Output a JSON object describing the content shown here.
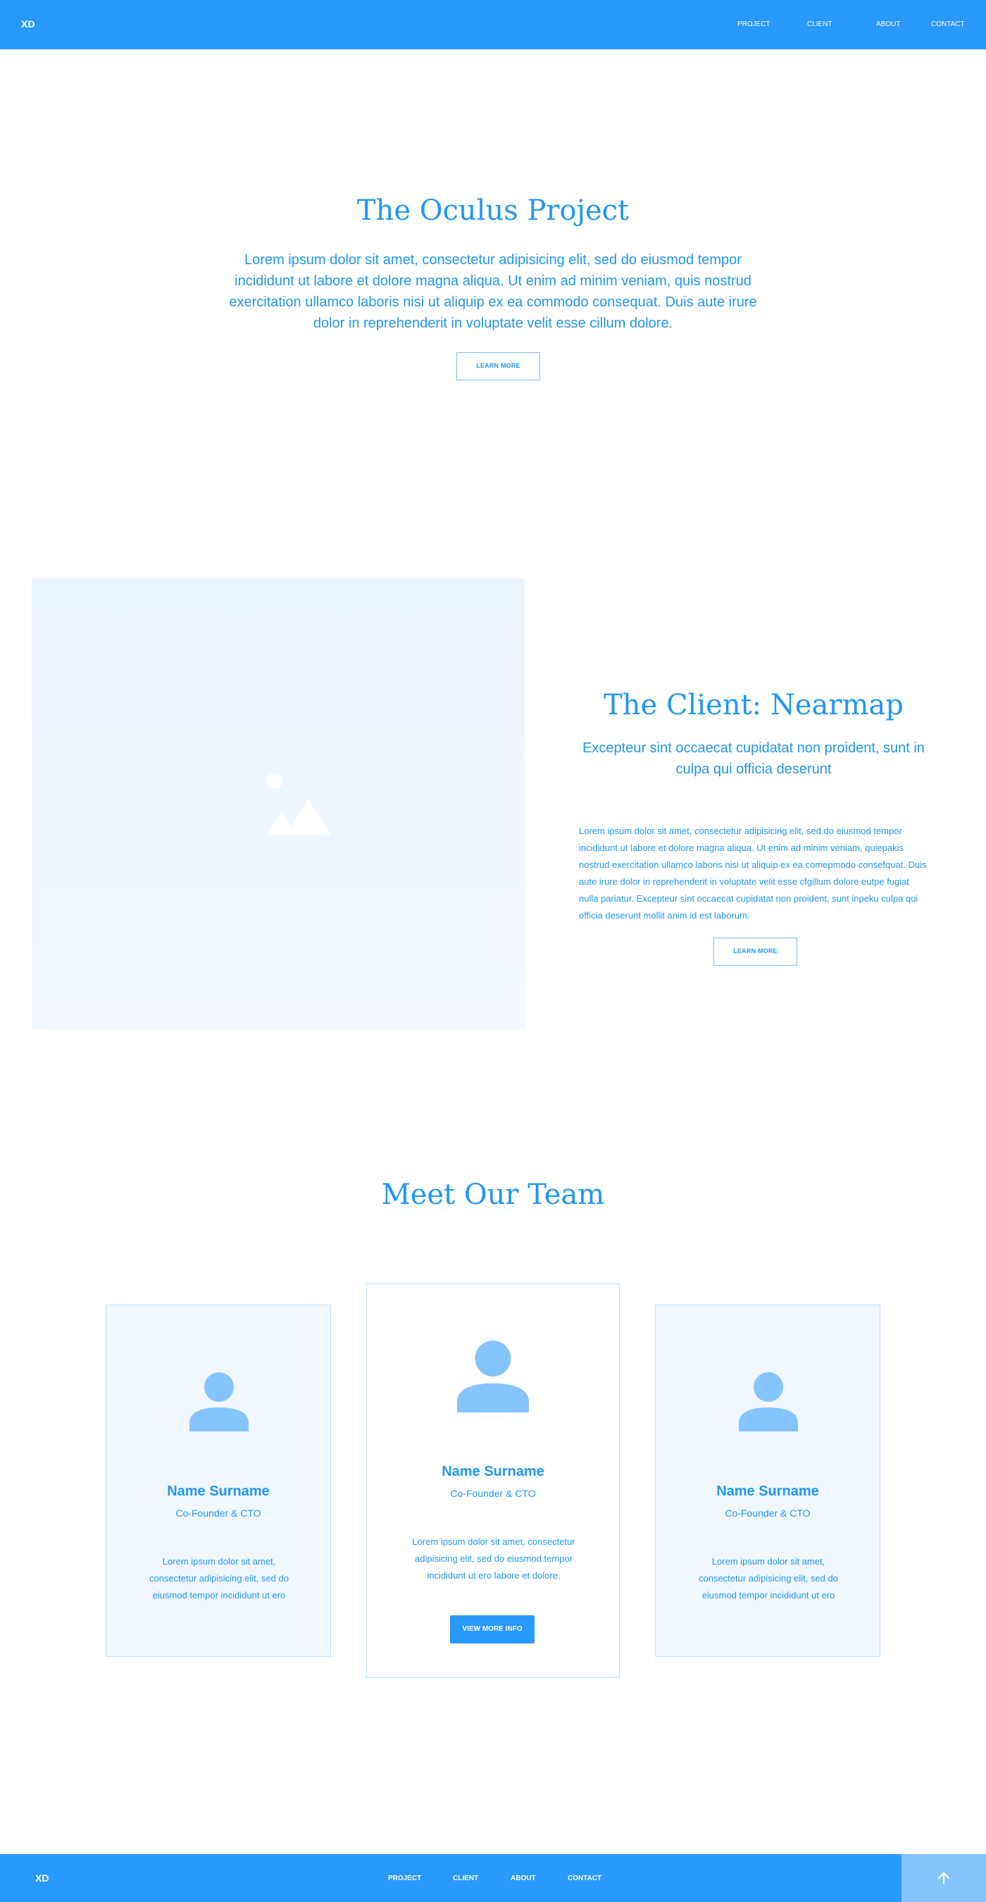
{
  "header": {
    "logo": "XD",
    "nav": [
      "PROJECT",
      "CLIENT",
      "ABOUT",
      "CONTACT"
    ]
  },
  "hero": {
    "title": "The Oculus Project",
    "text": "Lorem ipsum dolor sit amet, consectetur adipisicing elit, sed do eiusmod tempor incididunt ut labore et dolore magna aliqua. Ut enim ad minim veniam, quis nostrud exercitation ullamco laboris nisi ut aliquip ex ea commodo consequat. Duis aute irure dolor in reprehenderit in voluptate velit esse cillum dolore.",
    "button": "LEARN MORE"
  },
  "client": {
    "image_icon": "image-placeholder-icon",
    "title": "The Client: Nearmap",
    "subtitle": "Excepteur sint occaecat cupidatat non proident, sunt in culpa qui officia deserunt",
    "body": "Lorem ipsum dolor sit amet, consectetur adipisicing elit, sed do eiusmod tempor incididunt ut labore et dolore magna aliqua. Ut enim ad minim veniam, quiepakis nostrud exercitation ullamco laboris nisi ut aliquip ex ea comepmodo consefquat. Duis aute irure dolor in reprehenderit in voluptate velit esse cfgillum dolore eutpe fugiat nulla pariatur. Excepteur sint occaecat cupidatat non proident, sunt inpeku culpa qui officia deserunt mollit anim id est laborum.",
    "button": "LEARN MORE"
  },
  "team": {
    "title": "Meet Our Team",
    "members": [
      {
        "name": "Name Surname",
        "role": "Co-Founder & CTO",
        "desc": "Lorem ipsum dolor sit amet, consectetur adipisicing elit, sed do eiusmod tempor incididunt ut ero"
      },
      {
        "name": "Name Surname",
        "role": "Co-Founder & CTO",
        "desc": "Lorem ipsum dolor sit amet, consectetur adipisicing elit, sed do eiusmod tempor incididunt ut ero labore et dolore.",
        "button": "VIEW MORE INFO"
      },
      {
        "name": "Name Surname",
        "role": "Co-Founder & CTO",
        "desc": "Lorem ipsum dolor sit amet, consectetur adipisicing elit, sed do eiusmod tempor incididunt ut ero"
      }
    ]
  },
  "footer": {
    "logo": "XD",
    "nav": [
      "PROJECT",
      "CLIENT",
      "ABOUT",
      "CONTACT"
    ],
    "scroll_top_icon": "arrow-up-icon"
  },
  "colors": {
    "primary": "#2999fb",
    "text": "#2196f3",
    "light_panel": "#f0f7fe",
    "border": "#bfe0fd",
    "icon": "#85c4fc"
  }
}
